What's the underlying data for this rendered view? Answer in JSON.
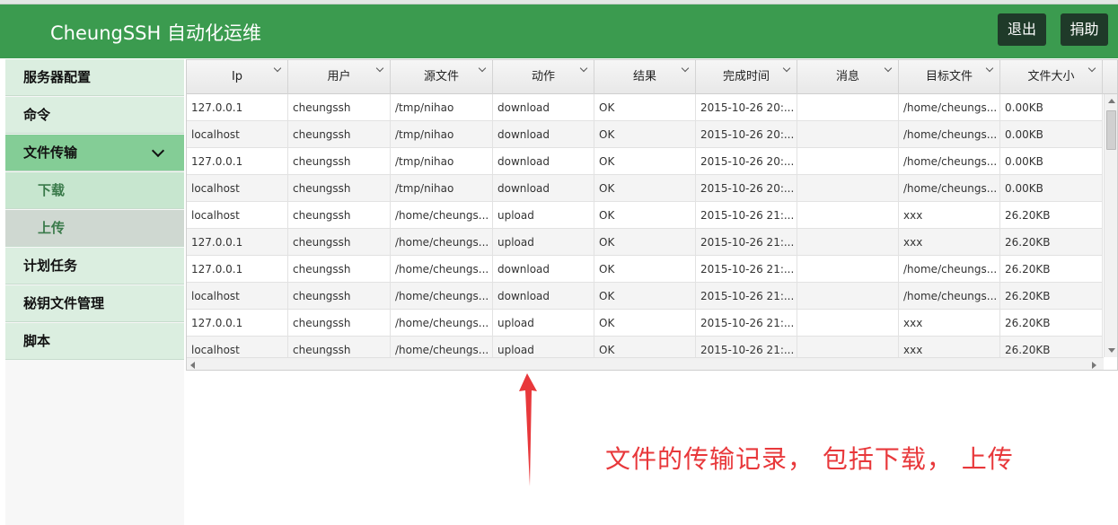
{
  "header": {
    "brand": "CheungSSH 自动化运维",
    "logout_label": "退出",
    "donate_label": "捐助"
  },
  "sidebar": {
    "items": [
      {
        "label": "服务器配置"
      },
      {
        "label": "命令"
      },
      {
        "label": "文件传输",
        "icon": "chevron-down-icon"
      },
      {
        "label": "下载"
      },
      {
        "label": "上传"
      },
      {
        "label": "计划任务"
      },
      {
        "label": "秘钥文件管理"
      },
      {
        "label": "脚本"
      }
    ]
  },
  "table": {
    "columns": [
      "Ip",
      "用户",
      "源文件",
      "动作",
      "结果",
      "完成时间",
      "消息",
      "目标文件",
      "文件大小"
    ],
    "rows": [
      [
        "127.0.0.1",
        "cheungssh",
        "/tmp/nihao",
        "download",
        "OK",
        "2015-10-26 20:...",
        "",
        "/home/cheungs...",
        "0.00KB"
      ],
      [
        "localhost",
        "cheungssh",
        "/tmp/nihao",
        "download",
        "OK",
        "2015-10-26 20:...",
        "",
        "/home/cheungs...",
        "0.00KB"
      ],
      [
        "127.0.0.1",
        "cheungssh",
        "/tmp/nihao",
        "download",
        "OK",
        "2015-10-26 20:...",
        "",
        "/home/cheungs...",
        "0.00KB"
      ],
      [
        "localhost",
        "cheungssh",
        "/tmp/nihao",
        "download",
        "OK",
        "2015-10-26 20:...",
        "",
        "/home/cheungs...",
        "0.00KB"
      ],
      [
        "localhost",
        "cheungssh",
        "/home/cheungs...",
        "upload",
        "OK",
        "2015-10-26 21:...",
        "",
        "xxx",
        "26.20KB"
      ],
      [
        "127.0.0.1",
        "cheungssh",
        "/home/cheungs...",
        "upload",
        "OK",
        "2015-10-26 21:...",
        "",
        "xxx",
        "26.20KB"
      ],
      [
        "127.0.0.1",
        "cheungssh",
        "/home/cheungs...",
        "download",
        "OK",
        "2015-10-26 21:...",
        "",
        "/home/cheungs...",
        "26.20KB"
      ],
      [
        "localhost",
        "cheungssh",
        "/home/cheungs...",
        "download",
        "OK",
        "2015-10-26 21:...",
        "",
        "/home/cheungs...",
        "26.20KB"
      ],
      [
        "127.0.0.1",
        "cheungssh",
        "/home/cheungs...",
        "upload",
        "OK",
        "2015-10-26 21:...",
        "",
        "xxx",
        "26.20KB"
      ],
      [
        "localhost",
        "cheungssh",
        "/home/cheungs...",
        "upload",
        "OK",
        "2015-10-26 21:...",
        "",
        "xxx",
        "26.20KB"
      ]
    ]
  },
  "annotation": {
    "text": "文件的传输记录， 包括下载， 上传",
    "color": "#e8383b"
  },
  "colors": {
    "navbar": "#3b9b4f",
    "sidebar_active": "#84cd96",
    "sidebar_item": "#dbeee0",
    "button_dark": "#1f3a29"
  }
}
